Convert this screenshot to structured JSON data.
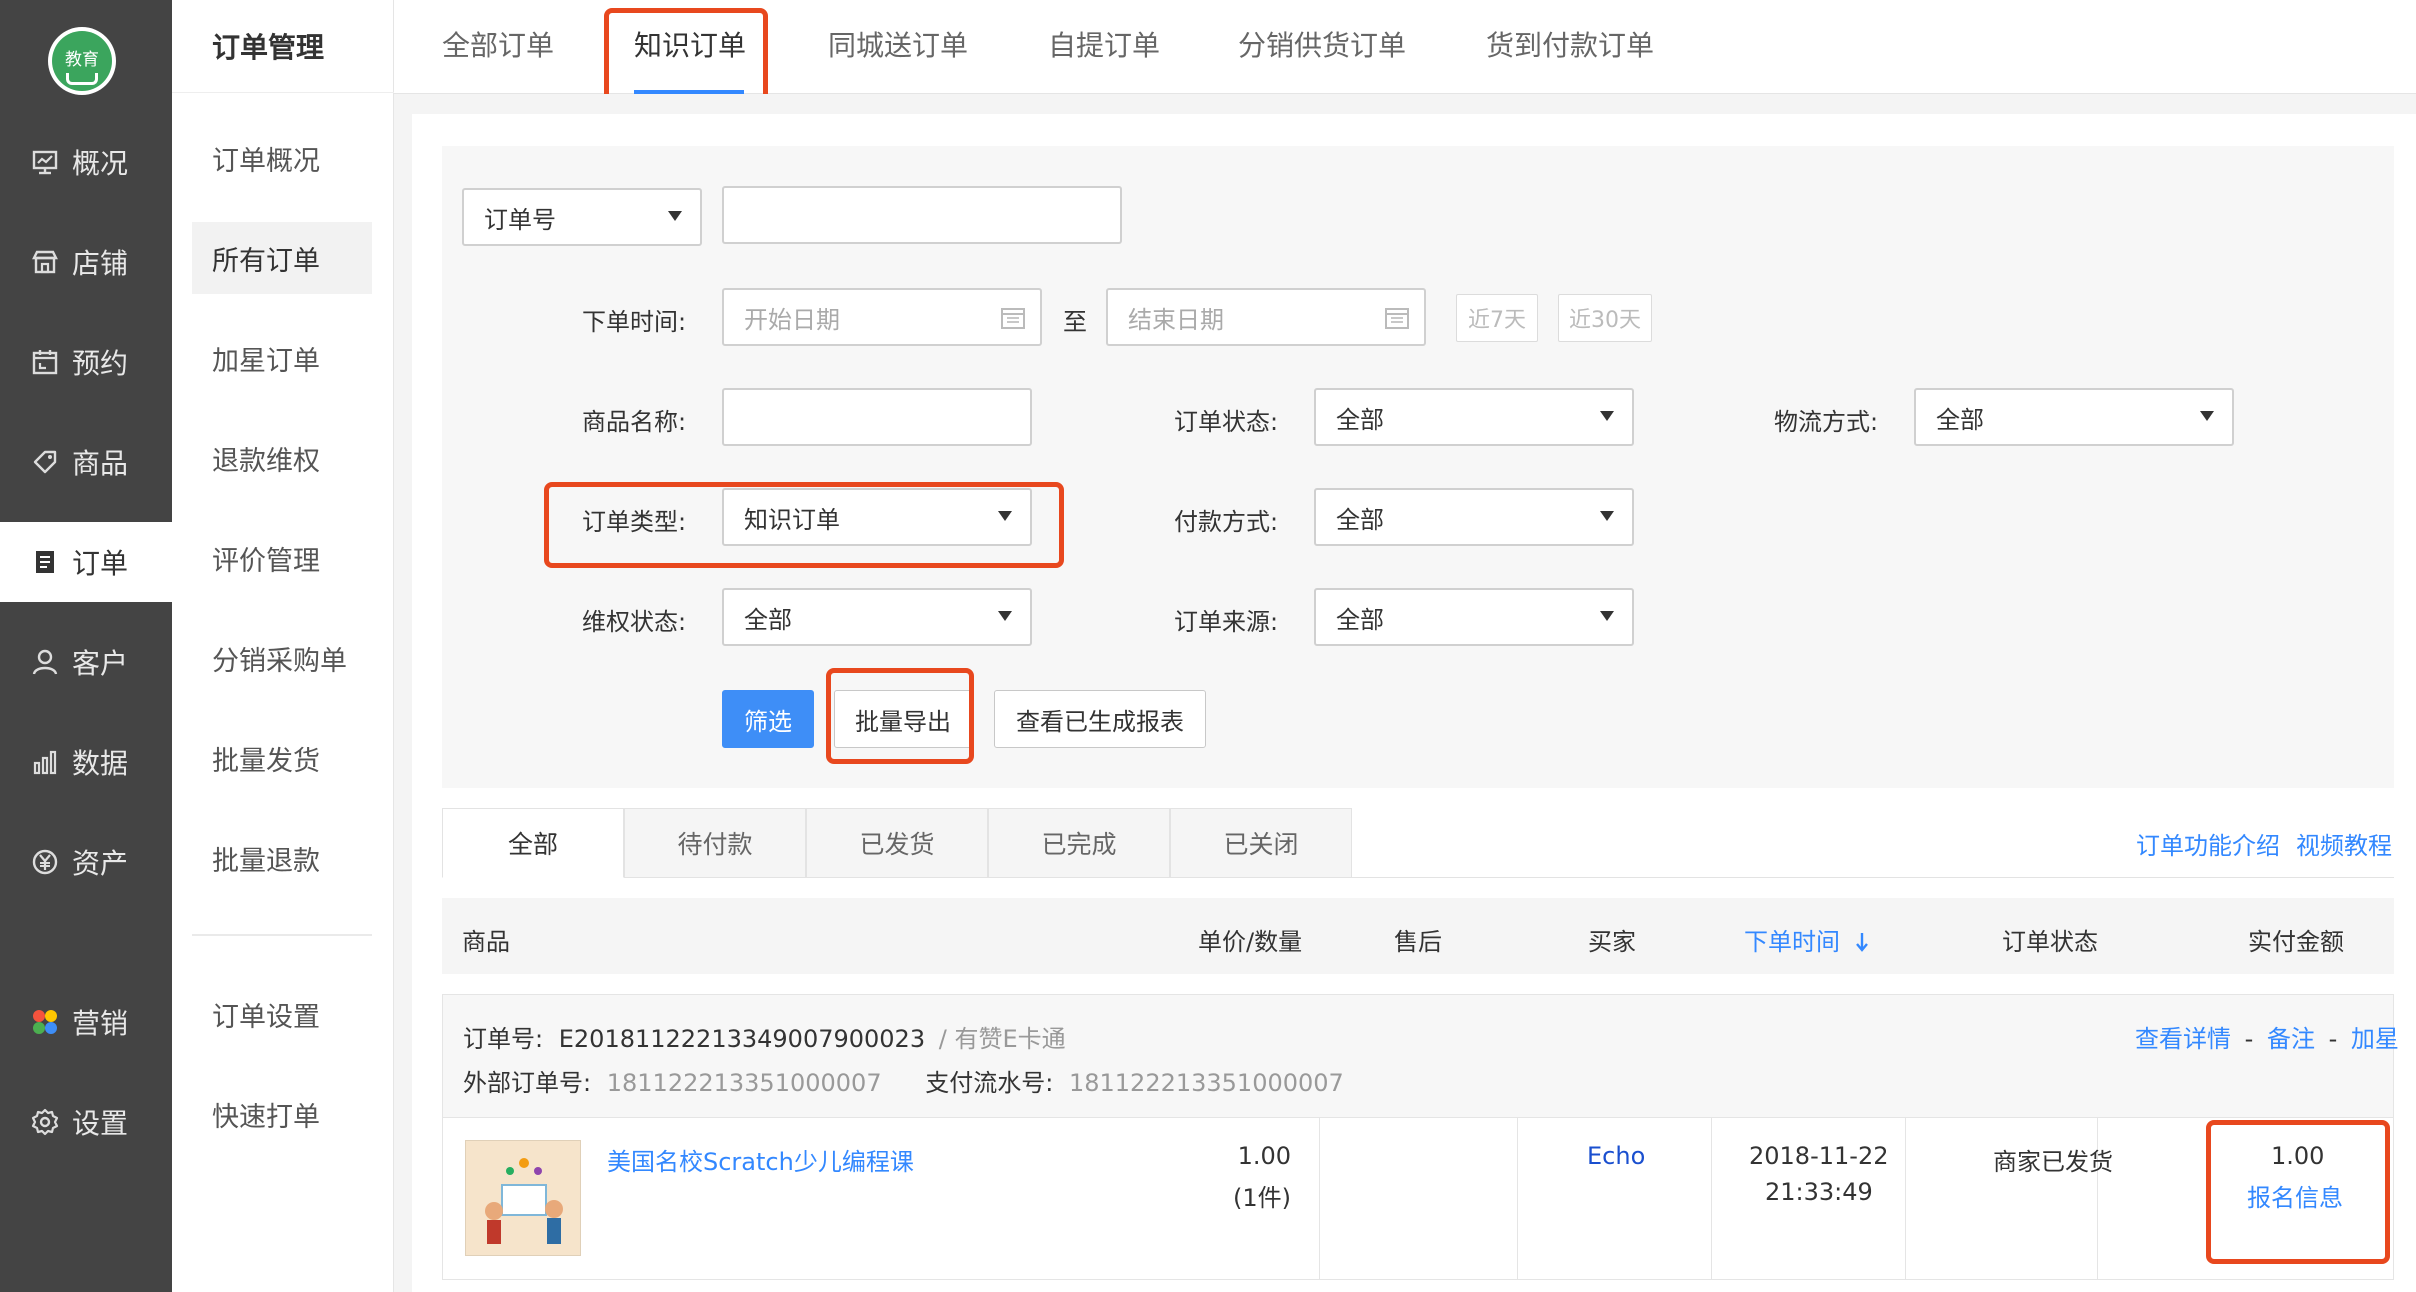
{
  "sidebar": {
    "logo_text": "教育",
    "items": [
      {
        "label": "概况",
        "icon": "dashboard-icon"
      },
      {
        "label": "店铺",
        "icon": "store-icon"
      },
      {
        "label": "预约",
        "icon": "calendar-icon"
      },
      {
        "label": "商品",
        "icon": "tag-icon"
      },
      {
        "label": "订单",
        "icon": "order-icon",
        "active": true
      },
      {
        "label": "客户",
        "icon": "user-icon"
      },
      {
        "label": "数据",
        "icon": "bar-chart-icon"
      },
      {
        "label": "资产",
        "icon": "yen-icon"
      },
      {
        "label": "营销",
        "icon": "marketing-icon"
      },
      {
        "label": "设置",
        "icon": "gear-icon"
      }
    ]
  },
  "submenu": {
    "title": "订单管理",
    "items": [
      "订单概况",
      "所有订单",
      "加星订单",
      "退款维权",
      "评价管理",
      "分销采购单",
      "批量发货",
      "批量退款"
    ],
    "items2": [
      "订单设置",
      "快速打单"
    ],
    "active": "所有订单"
  },
  "top_tabs": [
    "全部订单",
    "知识订单",
    "同城送订单",
    "自提订单",
    "分销供货订单",
    "货到付款订单"
  ],
  "filters": {
    "search_type": "订单号",
    "search_value": "",
    "order_time_label": "下单时间:",
    "start_placeholder": "开始日期",
    "to_label": "至",
    "end_placeholder": "结束日期",
    "last7": "近7天",
    "last30": "近30天",
    "product_name_label": "商品名称:",
    "order_status_label": "订单状态:",
    "order_status_value": "全部",
    "logistics_label": "物流方式:",
    "logistics_value": "全部",
    "order_type_label": "订单类型:",
    "order_type_value": "知识订单",
    "payment_label": "付款方式:",
    "payment_value": "全部",
    "rights_label": "维权状态:",
    "rights_value": "全部",
    "source_label": "订单来源:",
    "source_value": "全部",
    "filter_btn": "筛选",
    "export_btn": "批量导出",
    "report_btn": "查看已生成报表"
  },
  "status_tabs": [
    "全部",
    "待付款",
    "已发货",
    "已完成",
    "已关闭"
  ],
  "help_links": {
    "intro": "订单功能介绍",
    "video": "视频教程"
  },
  "table": {
    "headers": {
      "product": "商品",
      "price_qty": "单价/数量",
      "after_sale": "售后",
      "buyer": "买家",
      "order_time": "下单时间",
      "status": "订单状态",
      "paid": "实付金额"
    }
  },
  "order": {
    "order_no_label": "订单号:",
    "order_no": "E20181122213349007900023",
    "channel": "/ 有赞E卡通",
    "ext_no_label": "外部订单号:",
    "ext_no": "181122213351000007",
    "pay_no_label": "支付流水号:",
    "pay_no": "181122213351000007",
    "actions": {
      "detail": "查看详情",
      "sep1": "-",
      "remark": "备注",
      "sep2": "-",
      "star": "加星"
    },
    "product_title": "美国名校Scratch少儿编程课",
    "price": "1.00",
    "qty": "(1件)",
    "buyer": "Echo",
    "date": "2018-11-22",
    "time": "21:33:49",
    "status": "商家已发货",
    "paid": "1.00",
    "signup_link": "报名信息"
  },
  "colors": {
    "sidebar_bg": "#444444",
    "accent": "#3388ff",
    "highlight": "#e8481e",
    "primary_btn": "#3e8ef7"
  }
}
